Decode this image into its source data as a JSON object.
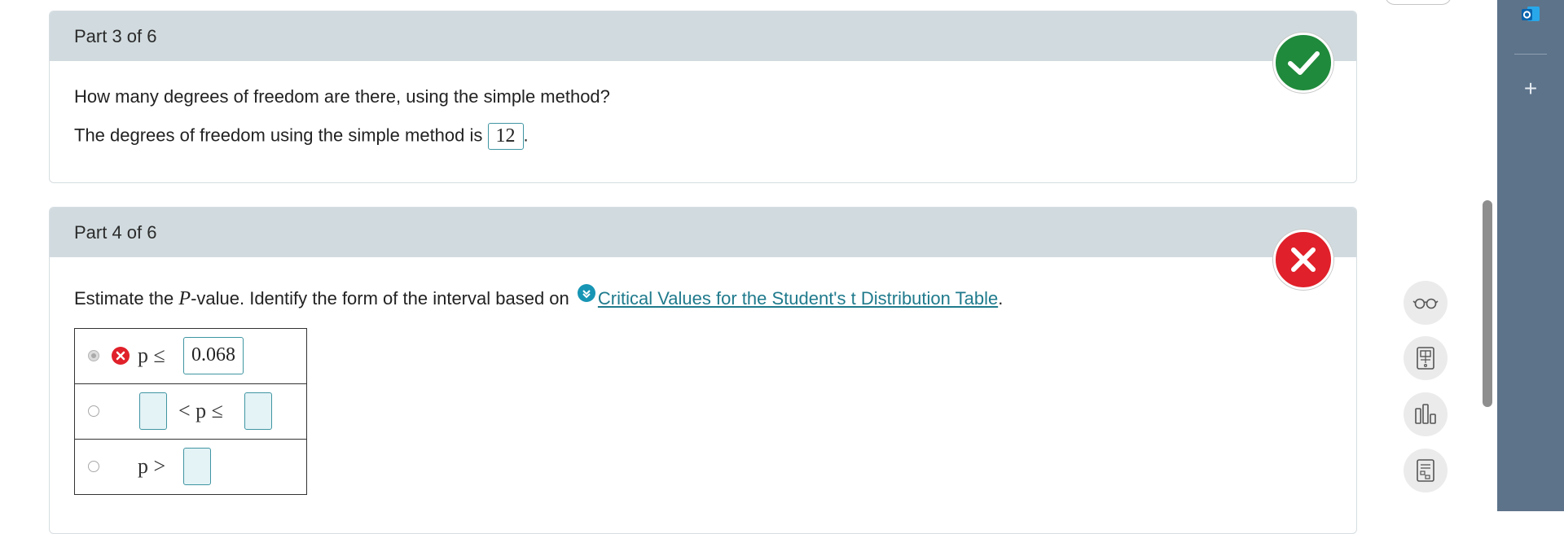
{
  "part3": {
    "header": "Part 3 of 6",
    "question": "How many degrees of freedom are there, using the simple method?",
    "answer_prefix": "The degrees of freedom using the simple method is",
    "answer_value": "12",
    "answer_suffix": ".",
    "status": "correct",
    "status_color": "#1f8a3b"
  },
  "part4": {
    "header": "Part 4 of 6",
    "question_prefix": "Estimate the ",
    "question_var": "P",
    "question_mid": "-value. Identify the form of the interval based on",
    "link_text": "Critical Values for the Student's t Distribution Table",
    "question_suffix": ".",
    "status": "incorrect",
    "status_color": "#e0202a",
    "options": [
      {
        "expr_left": "p ≤",
        "value": "0.068",
        "selected": true,
        "marked_wrong": true
      },
      {
        "expr_mid": "< p ≤",
        "selected": false
      },
      {
        "expr_left": "p >",
        "selected": false
      }
    ]
  },
  "tools": [
    "glasses-icon",
    "calculator-icon",
    "bar-chart-icon",
    "formula-sheet-icon"
  ],
  "sidebar": {
    "app_icon": "outlook-icon",
    "add_label": "+"
  }
}
